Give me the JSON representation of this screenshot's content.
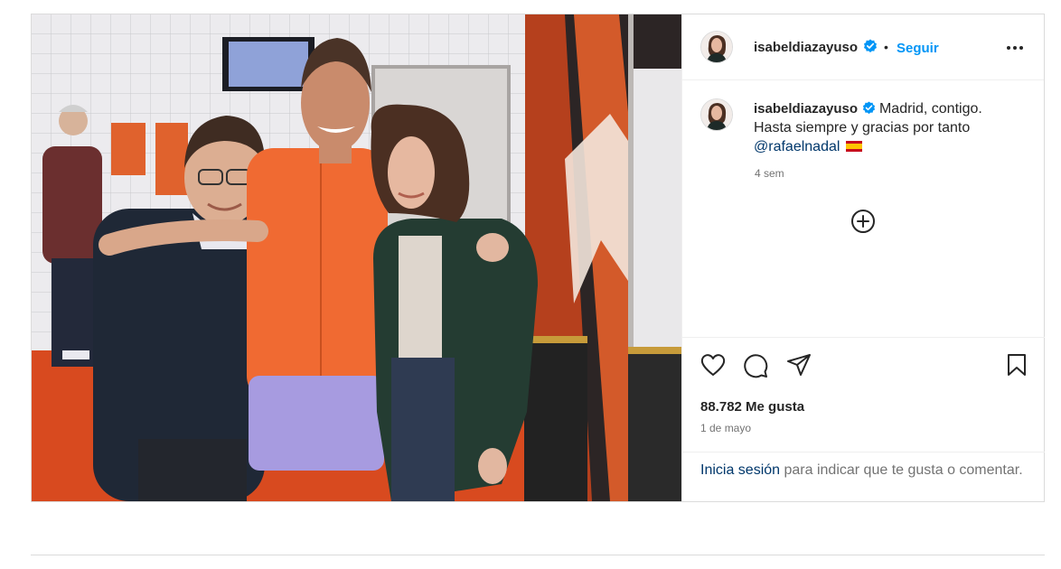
{
  "header": {
    "username": "isabeldiazayuso",
    "separator": "•",
    "follow_label": "Seguir",
    "more_icon": "more-options-icon"
  },
  "caption": {
    "username": "isabeldiazayuso",
    "line1": "Madrid, contigo.",
    "line2": "Hasta siempre y gracias por tanto",
    "mention": "@rafaelnadal",
    "flag_icon": "spain-flag-icon",
    "ago": "4 sem"
  },
  "load_more_icon": "plus-circle-icon",
  "actions": {
    "icons": [
      "heart-icon",
      "comment-icon",
      "share-icon",
      "save-icon"
    ],
    "likes": "88.782 Me gusta",
    "date": "1 de mayo"
  },
  "login": {
    "link": "Inicia sesión",
    "rest": "para indicar que te gusta o comentar."
  },
  "colors": {
    "accent": "#0095f6",
    "verified": "#0095f6",
    "link": "#00376b",
    "muted": "#737373",
    "border": "#dbdbdb"
  }
}
